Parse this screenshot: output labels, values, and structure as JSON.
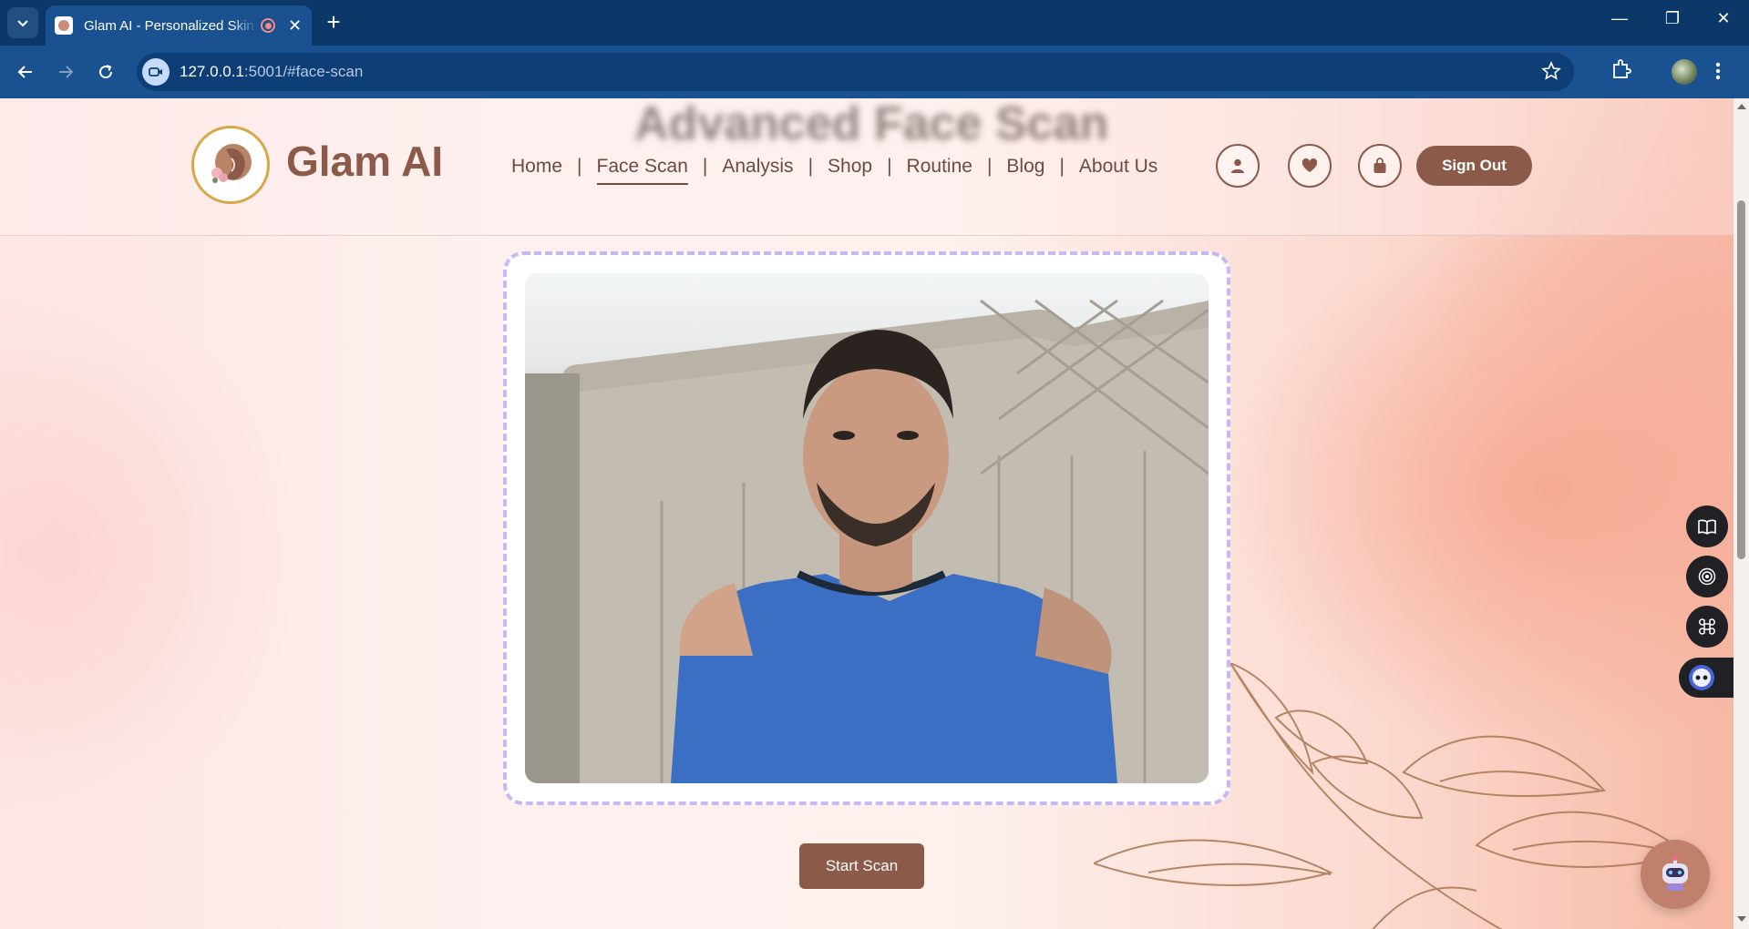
{
  "browser": {
    "tab_title": "Glam AI - Personalized Skin",
    "url_host": "127.0.0.1",
    "url_rest": ":5001/#face-scan"
  },
  "header": {
    "ghost_title": "Advanced Face Scan",
    "brand": "Glam AI",
    "nav": [
      "Home",
      "Face Scan",
      "Analysis",
      "Shop",
      "Routine",
      "Blog",
      "About Us"
    ],
    "nav_active": "Face Scan",
    "nav_separator": "|",
    "sign_out": "Sign Out"
  },
  "scan": {
    "start_label": "Start Scan"
  },
  "colors": {
    "brand_brown": "#8b5a48",
    "frame_dashed": "#c9b6f2",
    "browser_titlebar": "#0b3868",
    "browser_toolbar": "#1a5190"
  },
  "icons": {
    "header": [
      "user-icon",
      "heart-icon",
      "shopping-bag-icon"
    ],
    "side_tools": [
      "book-icon",
      "broadcast-icon",
      "command-icon",
      "assistant-icon"
    ],
    "chatbot": "robot-icon"
  }
}
